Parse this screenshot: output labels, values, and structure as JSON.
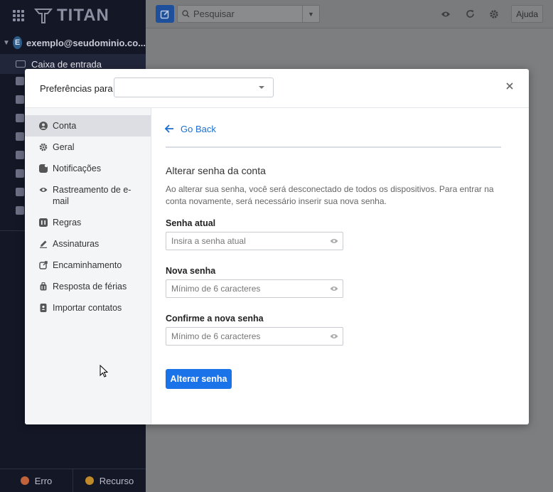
{
  "app": {
    "logo_text": "TITAN",
    "account_initial": "E",
    "account_email": "exemplo@seudominio.co...",
    "inbox_label": "Caixa de entrada",
    "search_placeholder": "Pesquisar",
    "help_label": "Ajuda",
    "footer": {
      "error_label": "Erro",
      "feature_label": "Recurso"
    }
  },
  "modal": {
    "preferences_label": "Preferências para",
    "preferences_value": "",
    "nav": [
      {
        "label": "Conta",
        "icon": "user-icon",
        "active": true
      },
      {
        "label": "Geral",
        "icon": "gear-icon",
        "active": false
      },
      {
        "label": "Notificações",
        "icon": "bell-icon",
        "active": false
      },
      {
        "label": "Rastreamento de e-mail",
        "icon": "eye-icon",
        "active": false
      },
      {
        "label": "Regras",
        "icon": "rules-icon",
        "active": false
      },
      {
        "label": "Assinaturas",
        "icon": "pen-icon",
        "active": false
      },
      {
        "label": "Encaminhamento",
        "icon": "forward-icon",
        "active": false
      },
      {
        "label": "Resposta de férias",
        "icon": "vacation-icon",
        "active": false
      },
      {
        "label": "Importar contatos",
        "icon": "contacts-icon",
        "active": false
      }
    ],
    "content": {
      "go_back": "Go Back",
      "title": "Alterar senha da conta",
      "description": "Ao alterar sua senha, você será desconectado de todos os dispositivos. Para entrar na conta novamente, será necessário inserir sua nova senha.",
      "fields": [
        {
          "label": "Senha atual",
          "placeholder": "Insira a senha atual",
          "value": ""
        },
        {
          "label": "Nova senha",
          "placeholder": "Mínimo de 6 caracteres",
          "value": ""
        },
        {
          "label": "Confirme a nova senha",
          "placeholder": "Mínimo de 6 caracteres",
          "value": ""
        }
      ],
      "submit_label": "Alterar senha"
    }
  },
  "colors": {
    "accent": "#1a73e8",
    "link": "#1a6fd1",
    "sidebar_bg": "#141726"
  }
}
